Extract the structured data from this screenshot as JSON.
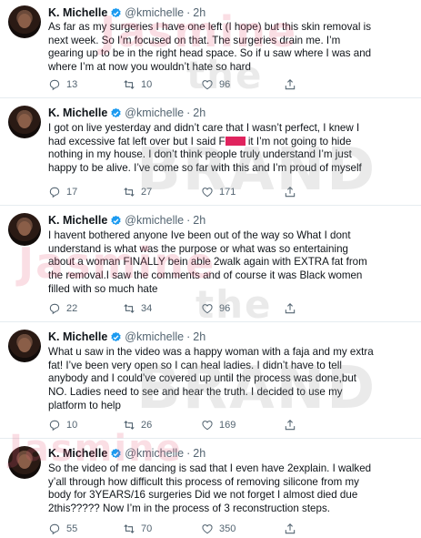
{
  "author": {
    "name": "K. Michelle",
    "handle": "@kmichelle",
    "separator": "·"
  },
  "tweets": [
    {
      "time": "2h",
      "lines": [
        "As far as my surgeries I have one left (I hope) but this skin removal is",
        "next week. So I’m focused on that. The surgeries drain me. I’m",
        "gearing up to be in the right head space. So if u saw where I was and",
        "where I’m at now you wouldn’t hate so hard"
      ],
      "replies": "13",
      "retweets": "10",
      "likes": "96"
    },
    {
      "time": "2h",
      "lines": [
        "I got on live yesterday and didn’t care that I wasn’t perfect, I knew I",
        "had excessive fat left over but I said F",
        "nothing in my house. I don’t think people truly understand I’m just",
        "happy to be alive. I’ve come so far with this and I’m proud of myself"
      ],
      "line2_after_redaction": " it I’m not going to hide",
      "replies": "17",
      "retweets": "27",
      "likes": "171"
    },
    {
      "time": "2h",
      "lines": [
        "I havent bothered anyone Ive been out of the way so What I dont",
        "understand is what was the purpose or what was so entertaining",
        "about a woman FINALLY bein able 2walk again with EXTRA fat from",
        "the removal.I saw the comments and of course it was Black women",
        "filled with so much hate"
      ],
      "replies": "22",
      "retweets": "34",
      "likes": "96"
    },
    {
      "time": "2h",
      "lines": [
        "What u saw in the video was a happy woman with a faja and my extra",
        "fat! I’ve been very open so I can heal ladies. I didn’t have to tell",
        "anybody and I could’ve covered up until the process was done,but",
        "NO. Ladies need to see and hear the truth. I decided to use my",
        "platform to help"
      ],
      "replies": "10",
      "retweets": "26",
      "likes": "169"
    },
    {
      "time": "2h",
      "lines": [
        "So the video of me dancing is sad that I even have 2explain. I walked",
        "y’all through how difficult this process of removing silicone from my",
        "body for 3YEARS/16 surgeries Did we not forget I almost died due",
        "2this?????  Now I’m in the process of 3 reconstruction steps."
      ],
      "replies": "55",
      "retweets": "70",
      "likes": "350"
    }
  ],
  "watermark": {
    "line1": "the",
    "line2": "Jasmine",
    "line3": "BRAND"
  },
  "colors": {
    "verified": "#1d9bf0",
    "muted": "#536471",
    "redaction": "#e0245e"
  }
}
